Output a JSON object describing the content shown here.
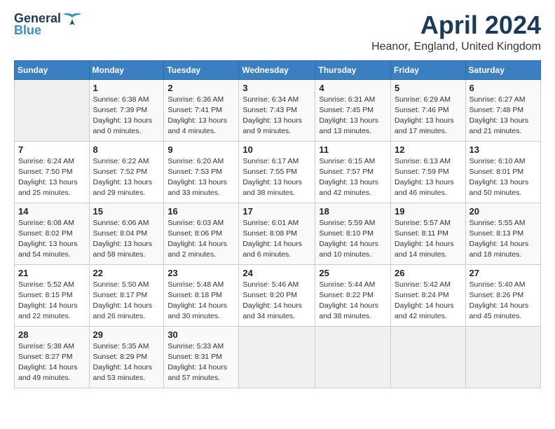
{
  "logo": {
    "general": "General",
    "blue": "Blue"
  },
  "title": "April 2024",
  "subtitle": "Heanor, England, United Kingdom",
  "weekdays": [
    "Sunday",
    "Monday",
    "Tuesday",
    "Wednesday",
    "Thursday",
    "Friday",
    "Saturday"
  ],
  "weeks": [
    [
      {
        "day": "",
        "info": ""
      },
      {
        "day": "1",
        "info": "Sunrise: 6:38 AM\nSunset: 7:39 PM\nDaylight: 13 hours\nand 0 minutes."
      },
      {
        "day": "2",
        "info": "Sunrise: 6:36 AM\nSunset: 7:41 PM\nDaylight: 13 hours\nand 4 minutes."
      },
      {
        "day": "3",
        "info": "Sunrise: 6:34 AM\nSunset: 7:43 PM\nDaylight: 13 hours\nand 9 minutes."
      },
      {
        "day": "4",
        "info": "Sunrise: 6:31 AM\nSunset: 7:45 PM\nDaylight: 13 hours\nand 13 minutes."
      },
      {
        "day": "5",
        "info": "Sunrise: 6:29 AM\nSunset: 7:46 PM\nDaylight: 13 hours\nand 17 minutes."
      },
      {
        "day": "6",
        "info": "Sunrise: 6:27 AM\nSunset: 7:48 PM\nDaylight: 13 hours\nand 21 minutes."
      }
    ],
    [
      {
        "day": "7",
        "info": "Sunrise: 6:24 AM\nSunset: 7:50 PM\nDaylight: 13 hours\nand 25 minutes."
      },
      {
        "day": "8",
        "info": "Sunrise: 6:22 AM\nSunset: 7:52 PM\nDaylight: 13 hours\nand 29 minutes."
      },
      {
        "day": "9",
        "info": "Sunrise: 6:20 AM\nSunset: 7:53 PM\nDaylight: 13 hours\nand 33 minutes."
      },
      {
        "day": "10",
        "info": "Sunrise: 6:17 AM\nSunset: 7:55 PM\nDaylight: 13 hours\nand 38 minutes."
      },
      {
        "day": "11",
        "info": "Sunrise: 6:15 AM\nSunset: 7:57 PM\nDaylight: 13 hours\nand 42 minutes."
      },
      {
        "day": "12",
        "info": "Sunrise: 6:13 AM\nSunset: 7:59 PM\nDaylight: 13 hours\nand 46 minutes."
      },
      {
        "day": "13",
        "info": "Sunrise: 6:10 AM\nSunset: 8:01 PM\nDaylight: 13 hours\nand 50 minutes."
      }
    ],
    [
      {
        "day": "14",
        "info": "Sunrise: 6:08 AM\nSunset: 8:02 PM\nDaylight: 13 hours\nand 54 minutes."
      },
      {
        "day": "15",
        "info": "Sunrise: 6:06 AM\nSunset: 8:04 PM\nDaylight: 13 hours\nand 58 minutes."
      },
      {
        "day": "16",
        "info": "Sunrise: 6:03 AM\nSunset: 8:06 PM\nDaylight: 14 hours\nand 2 minutes."
      },
      {
        "day": "17",
        "info": "Sunrise: 6:01 AM\nSunset: 8:08 PM\nDaylight: 14 hours\nand 6 minutes."
      },
      {
        "day": "18",
        "info": "Sunrise: 5:59 AM\nSunset: 8:10 PM\nDaylight: 14 hours\nand 10 minutes."
      },
      {
        "day": "19",
        "info": "Sunrise: 5:57 AM\nSunset: 8:11 PM\nDaylight: 14 hours\nand 14 minutes."
      },
      {
        "day": "20",
        "info": "Sunrise: 5:55 AM\nSunset: 8:13 PM\nDaylight: 14 hours\nand 18 minutes."
      }
    ],
    [
      {
        "day": "21",
        "info": "Sunrise: 5:52 AM\nSunset: 8:15 PM\nDaylight: 14 hours\nand 22 minutes."
      },
      {
        "day": "22",
        "info": "Sunrise: 5:50 AM\nSunset: 8:17 PM\nDaylight: 14 hours\nand 26 minutes."
      },
      {
        "day": "23",
        "info": "Sunrise: 5:48 AM\nSunset: 8:18 PM\nDaylight: 14 hours\nand 30 minutes."
      },
      {
        "day": "24",
        "info": "Sunrise: 5:46 AM\nSunset: 8:20 PM\nDaylight: 14 hours\nand 34 minutes."
      },
      {
        "day": "25",
        "info": "Sunrise: 5:44 AM\nSunset: 8:22 PM\nDaylight: 14 hours\nand 38 minutes."
      },
      {
        "day": "26",
        "info": "Sunrise: 5:42 AM\nSunset: 8:24 PM\nDaylight: 14 hours\nand 42 minutes."
      },
      {
        "day": "27",
        "info": "Sunrise: 5:40 AM\nSunset: 8:26 PM\nDaylight: 14 hours\nand 45 minutes."
      }
    ],
    [
      {
        "day": "28",
        "info": "Sunrise: 5:38 AM\nSunset: 8:27 PM\nDaylight: 14 hours\nand 49 minutes."
      },
      {
        "day": "29",
        "info": "Sunrise: 5:35 AM\nSunset: 8:29 PM\nDaylight: 14 hours\nand 53 minutes."
      },
      {
        "day": "30",
        "info": "Sunrise: 5:33 AM\nSunset: 8:31 PM\nDaylight: 14 hours\nand 57 minutes."
      },
      {
        "day": "",
        "info": ""
      },
      {
        "day": "",
        "info": ""
      },
      {
        "day": "",
        "info": ""
      },
      {
        "day": "",
        "info": ""
      }
    ]
  ]
}
